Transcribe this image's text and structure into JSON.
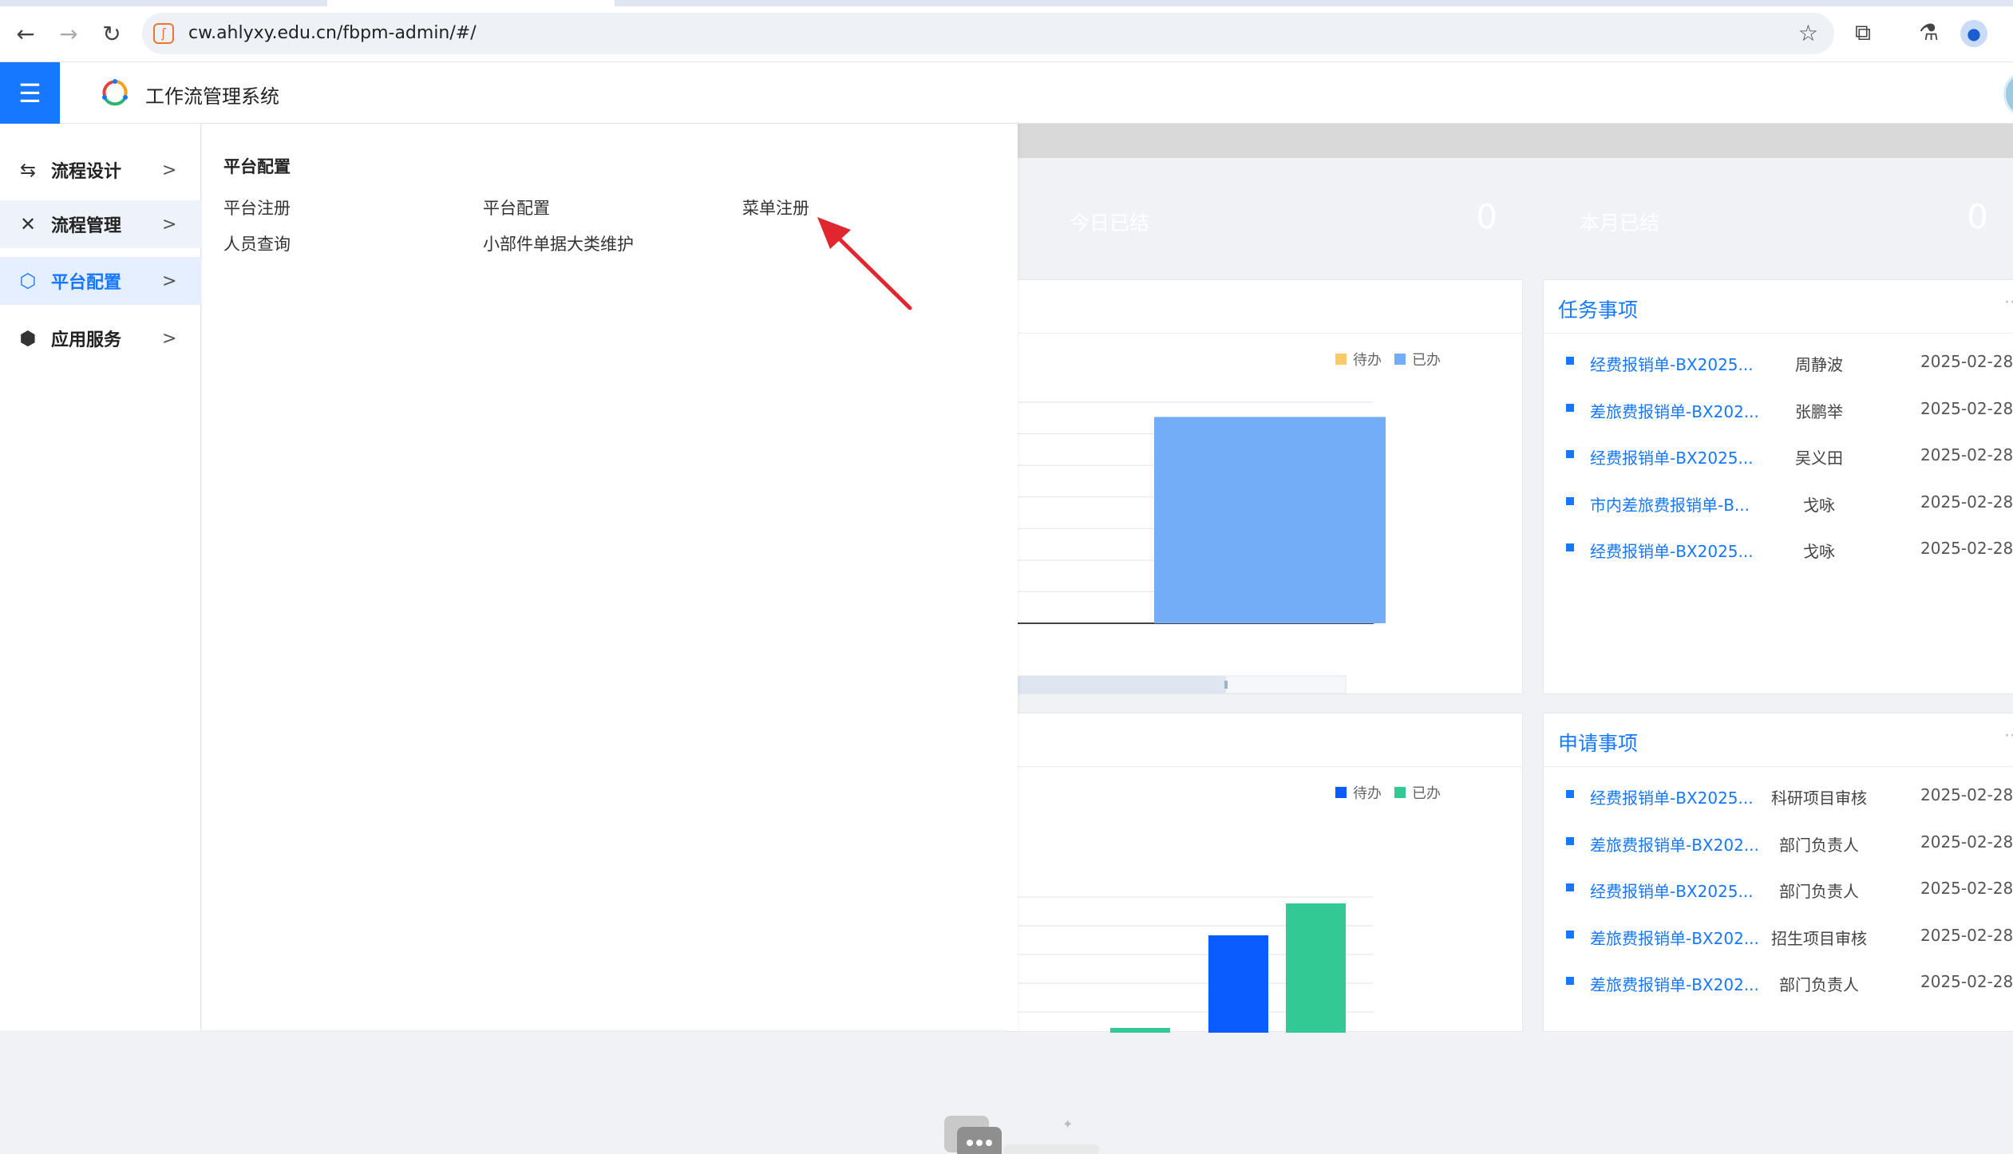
{
  "browser": {
    "url": "cw.ahlyxy.edu.cn/fbpm-admin/#/",
    "icons": [
      "back-arrow-icon",
      "forward-arrow-icon",
      "reload-icon",
      "star-icon",
      "extensions-icon",
      "labs-flask-icon",
      "profile-icon"
    ]
  },
  "header": {
    "title": "工作流管理系统",
    "menu_icon": "hamburger-icon"
  },
  "sidebar": {
    "items": [
      {
        "label": "流程设计",
        "icon": "flow-design-icon",
        "state": "normal"
      },
      {
        "label": "流程管理",
        "icon": "wrench-icon",
        "state": "hover"
      },
      {
        "label": "平台配置",
        "icon": "hexagon-settings-icon",
        "state": "active"
      },
      {
        "label": "应用服务",
        "icon": "cube-icon",
        "state": "normal"
      }
    ]
  },
  "flyout": {
    "title": "平台配置",
    "links": [
      "平台注册",
      "平台配置",
      "菜单注册",
      "人员查询",
      "小部件单据大类维护"
    ]
  },
  "stats": [
    {
      "label": "今日已结",
      "value": "0",
      "color": "#ff6633"
    },
    {
      "label": "本月已结",
      "value": "0",
      "color": "#0a9dff"
    }
  ],
  "chart_data": [
    {
      "type": "bar",
      "legend": [
        "待办",
        "已办"
      ],
      "colors": [
        "#ffc86b",
        "#74adf7"
      ],
      "series": [
        {
          "name": "待办",
          "values": [
            0
          ]
        },
        {
          "name": "已办",
          "values": [
            7
          ]
        }
      ],
      "ylim": [
        0,
        7.5
      ],
      "grid": true
    },
    {
      "type": "bar",
      "legend": [
        "待办",
        "已办"
      ],
      "colors": [
        "#0a5cff",
        "#33c995"
      ],
      "series": [
        {
          "name": "待办",
          "values": [
            0.2,
            3.3
          ]
        },
        {
          "name": "已办",
          "values": [
            0.4,
            4.3
          ]
        }
      ],
      "ylim": [
        0,
        4.5
      ],
      "grid": true
    }
  ],
  "tasks": {
    "title": "任务事项",
    "more": "···",
    "rows": [
      {
        "name": "经费报销单-BX2025...",
        "who": "周静波",
        "date": "2025-02-28"
      },
      {
        "name": "差旅费报销单-BX202...",
        "who": "张鹏举",
        "date": "2025-02-28"
      },
      {
        "name": "经费报销单-BX2025...",
        "who": "吴义田",
        "date": "2025-02-28"
      },
      {
        "name": "市内差旅费报销单-B...",
        "who": "戈咏",
        "date": "2025-02-28"
      },
      {
        "name": "经费报销单-BX2025...",
        "who": "戈咏",
        "date": "2025-02-28"
      }
    ]
  },
  "requests": {
    "title": "申请事项",
    "more": "···",
    "rows": [
      {
        "name": "经费报销单-BX2025...",
        "who": "科研项目审核",
        "date": "2025-02-28"
      },
      {
        "name": "差旅费报销单-BX202...",
        "who": "部门负责人",
        "date": "2025-02-28"
      },
      {
        "name": "经费报销单-BX2025...",
        "who": "部门负责人",
        "date": "2025-02-28"
      },
      {
        "name": "差旅费报销单-BX202...",
        "who": "招生项目审核",
        "date": "2025-02-28"
      },
      {
        "name": "差旅费报销单-BX202...",
        "who": "部门负责人",
        "date": "2025-02-28"
      }
    ]
  }
}
